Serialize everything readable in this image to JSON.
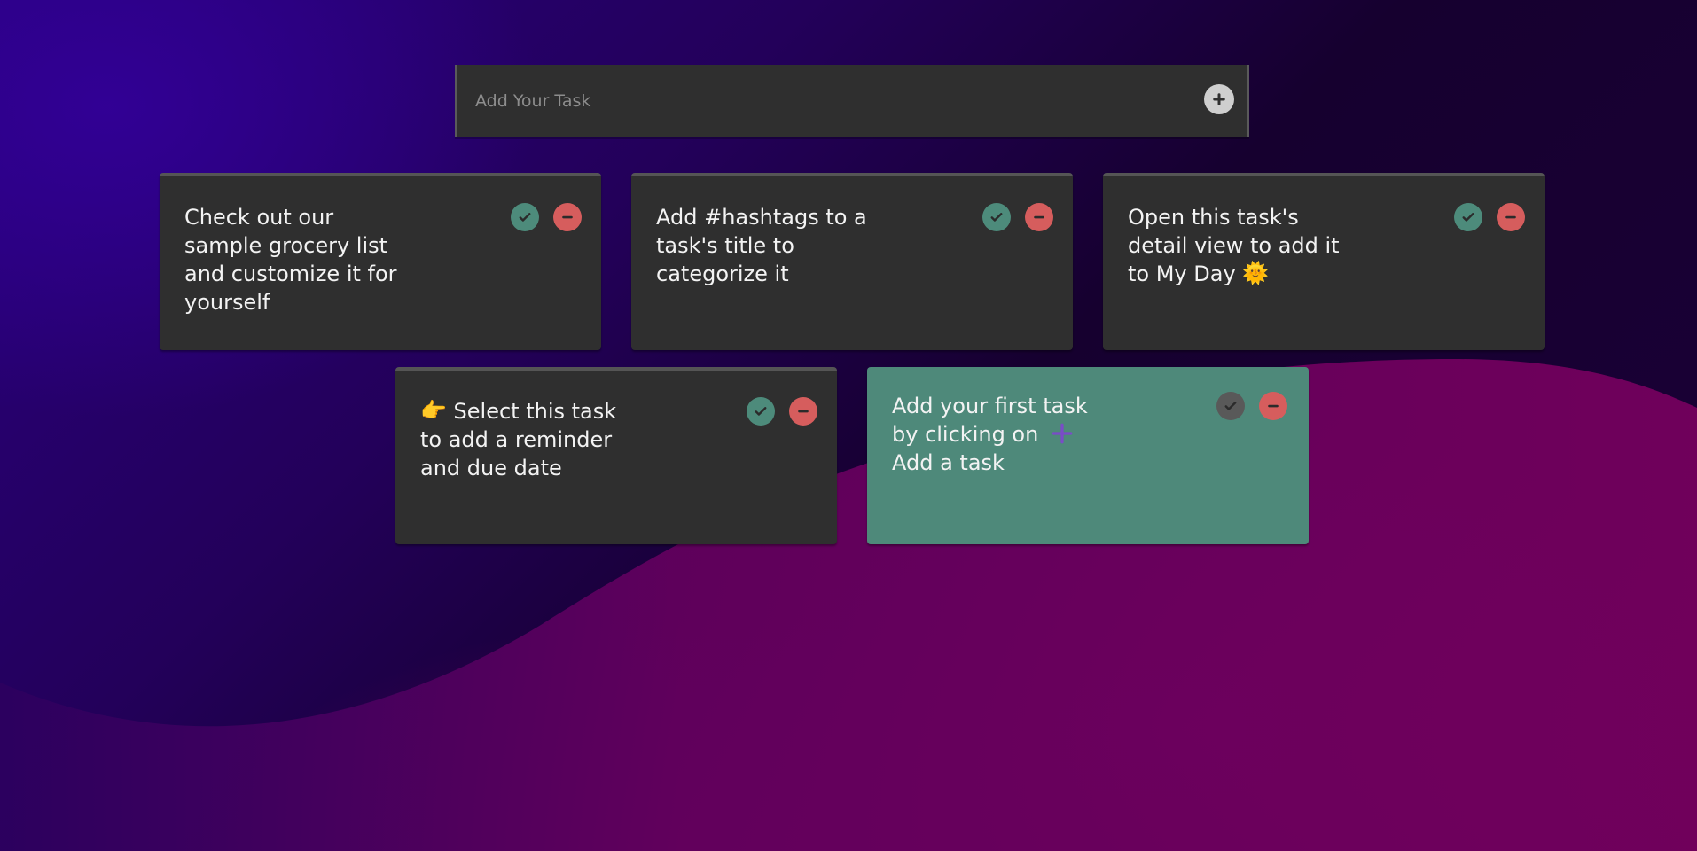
{
  "composer": {
    "placeholder": "Add Your Task",
    "add_icon": "plus-circle-icon"
  },
  "tasks": [
    {
      "title": "Check out our sample grocery list and customize it for yourself",
      "complete_icon": "check-circle-icon",
      "delete_icon": "minus-circle-icon"
    },
    {
      "title": "Add #hashtags to a task's title to categorize it",
      "complete_icon": "check-circle-icon",
      "delete_icon": "minus-circle-icon"
    },
    {
      "title": "Open this task's detail view to add it to My Day",
      "emoji": "🌞",
      "complete_icon": "check-circle-icon",
      "delete_icon": "minus-circle-icon"
    },
    {
      "title": "Select this task to add a reminder and due date",
      "emoji": "👉",
      "complete_icon": "check-circle-icon",
      "delete_icon": "minus-circle-icon"
    },
    {
      "title_line_1": "Add your first task by clicking on",
      "title_line_2": "Add a task",
      "inline_icon": "plus-icon",
      "complete_icon": "check-circle-icon",
      "delete_icon": "minus-circle-icon"
    }
  ],
  "colors": {
    "card_bg": "#2f2f2f",
    "highlight_card_bg": "#4e897a",
    "complete_green": "#4d8b7b",
    "delete_red": "#d65d5d",
    "inline_plus_purple": "#7a4cc8"
  }
}
